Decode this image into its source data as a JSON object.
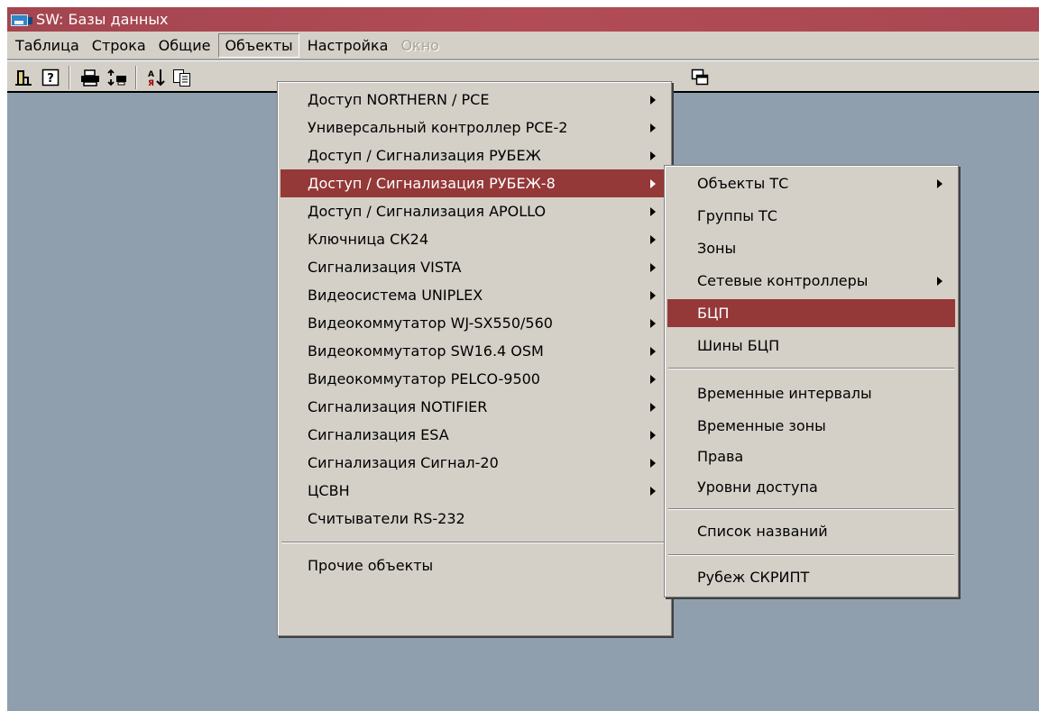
{
  "window": {
    "title": "SW: Базы данных"
  },
  "menubar": {
    "items": [
      {
        "label": "Таблица"
      },
      {
        "label": "Строка"
      },
      {
        "label": "Общие"
      },
      {
        "label": "Объекты"
      },
      {
        "label": "Настройка"
      },
      {
        "label": "Окно"
      }
    ]
  },
  "toolbar": {
    "buttons": [
      "exit-icon",
      "help-icon",
      "print-icon",
      "print-setup-icon",
      "sort-icon",
      "copy-icon",
      "window-icon"
    ]
  },
  "objects_menu": {
    "items": [
      {
        "label": "Доступ NORTHERN / PCE",
        "submenu": true
      },
      {
        "label": "Универсальный контроллер PCE-2",
        "submenu": true
      },
      {
        "label": "Доступ / Сигнализация РУБЕЖ",
        "submenu": true
      },
      {
        "label": "Доступ / Сигнализация РУБЕЖ-8",
        "submenu": true,
        "highlighted": true
      },
      {
        "label": "Доступ / Сигнализация APOLLO",
        "submenu": true
      },
      {
        "label": "Ключница СК24",
        "submenu": true
      },
      {
        "label": "Сигнализация VISTA",
        "submenu": true
      },
      {
        "label": "Видеосистема UNIPLEX",
        "submenu": true
      },
      {
        "label": "Видеокоммутатор WJ-SX550/560",
        "submenu": true
      },
      {
        "label": "Видеокоммутатор SW16.4 OSM",
        "submenu": true
      },
      {
        "label": "Видеокоммутатор PELCO-9500",
        "submenu": true
      },
      {
        "label": "Сигнализация NOTIFIER",
        "submenu": true
      },
      {
        "label": "Сигнализация ESA",
        "submenu": true
      },
      {
        "label": "Сигнализация Сигнал-20",
        "submenu": true
      },
      {
        "label": "ЦСВН",
        "submenu": true
      },
      {
        "label": "Считыватели RS-232",
        "submenu": false
      },
      {
        "label": "Прочие объекты",
        "submenu": false
      }
    ]
  },
  "rubezh8_submenu": {
    "items": [
      {
        "label": "Объекты ТС",
        "submenu": true
      },
      {
        "label": "Группы ТС"
      },
      {
        "label": "Зоны"
      },
      {
        "label": "Сетевые контроллеры",
        "submenu": true
      },
      {
        "label": "БЦП",
        "highlighted": true
      },
      {
        "label": "Шины БЦП"
      },
      {
        "label": "Временные интервалы"
      },
      {
        "label": "Временные зоны"
      },
      {
        "label": "Права"
      },
      {
        "label": "Уровни доступа"
      },
      {
        "label": "Список названий"
      },
      {
        "label": "Рубеж СКРИПТ"
      }
    ]
  },
  "colors": {
    "highlight": "#943838",
    "title_bar": "#ac4852",
    "desktop": "#8f9fae",
    "menu_bg": "#d4d0c8"
  }
}
